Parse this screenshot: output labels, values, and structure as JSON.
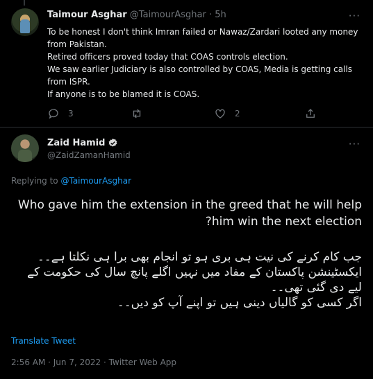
{
  "reply": {
    "author_name": "Taimour Asghar",
    "author_handle": "@TaimourAsghar",
    "separator": "·",
    "time": "5h",
    "lines": [
      "To be honest I don't think Imran failed or Nawaz/Zardari looted any money from Pakistan.",
      "Retired officers proved today that COAS controls election.",
      "We saw earlier Judiciary is also controlled by COAS, Media is getting calls from ISPR.",
      "If anyone is to be blamed it is COAS."
    ],
    "reply_count": "3",
    "retweet_count": "",
    "like_count": "2"
  },
  "tweet": {
    "author_name": "Zaid Hamid",
    "author_handle": "@ZaidZamanHamid",
    "replying_prefix": "Replying to",
    "replying_handle": "@TaimourAsghar",
    "english_text": "Who gave him the extension in the greed that he will help him win the next election?",
    "urdu_lines": [
      "جب کام کرنے  کی نیت ہی بری ہو تو انجام بھی برا ہی نکلتا ہے۔۔",
      "ایکسٹینشن پاکستان کے مفاد میں نہیں اگلے پانچ سال کی حکومت کے لیے دی گئی تھی۔۔",
      "اگر کسی کو گالیاں دینی ہیں تو اپنے آپ کو دیں۔۔"
    ],
    "translate_label": "Translate Tweet",
    "timestamp": "2:56 AM · Jun 7, 2022 · Twitter Web App"
  },
  "icons": {
    "more": "more-icon",
    "reply": "reply-icon",
    "retweet": "retweet-icon",
    "like": "like-icon",
    "share": "share-icon",
    "verified": "verified-icon"
  },
  "colors": {
    "background": "#000000",
    "text": "#e7e9ea",
    "muted": "#71767b",
    "link": "#1d9bf0",
    "divider": "#2f3336"
  }
}
